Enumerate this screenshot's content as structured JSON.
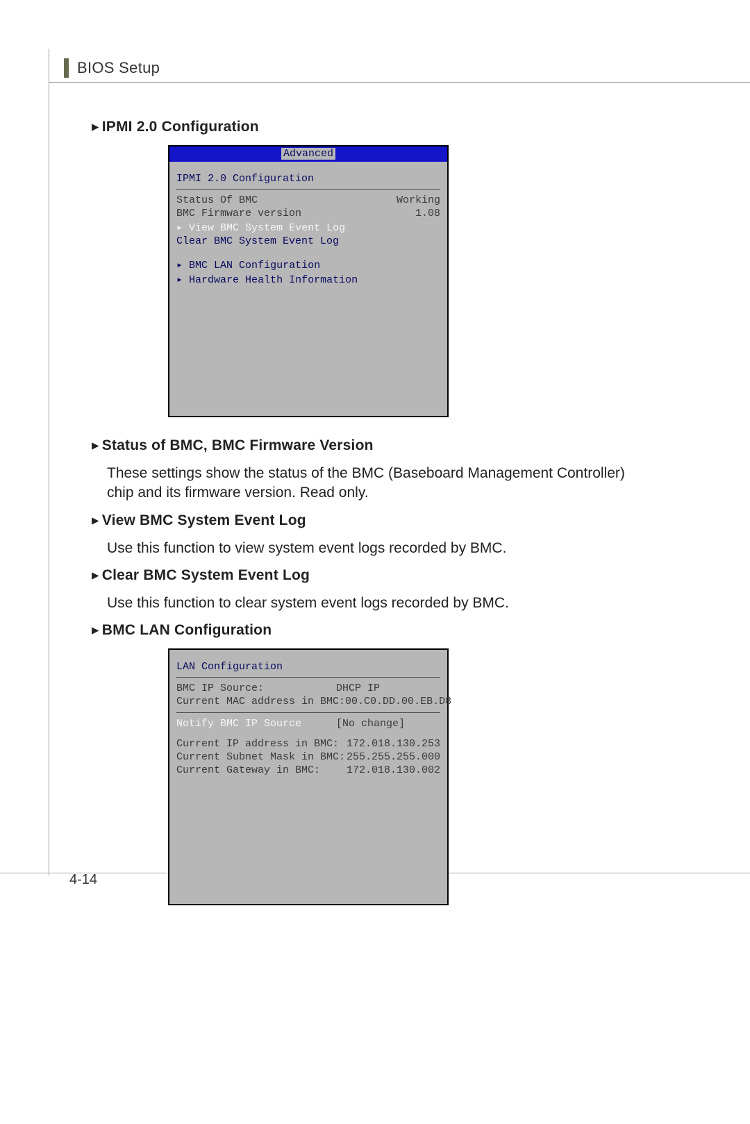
{
  "header": {
    "section": "BIOS Setup"
  },
  "page_number": "4-14",
  "titles": {
    "ipmi": "IPMI 2.0 Configuration",
    "status": "Status of BMC, BMC Firmware Version",
    "view": "View BMC System Event Log",
    "clear": "Clear BMC System Event Log",
    "lan": "BMC LAN Configuration"
  },
  "desc": {
    "status": "These settings show the status of the BMC (Baseboard Management Controller) chip and its firmware version. Read only.",
    "view": "Use this function to view system event logs recorded by BMC.",
    "clear": "Use this function to clear system event logs recorded by BMC."
  },
  "bios1": {
    "tab": "Advanced",
    "title": "IPMI 2.0 Configuration",
    "status_label": "Status Of BMC",
    "status_value": "Working",
    "fw_label": "BMC Firmware version",
    "fw_value": "1.08",
    "menu": {
      "view": "View BMC System Event Log",
      "clear": "Clear BMC System Event Log",
      "lan": "BMC LAN Configuration",
      "hw": "Hardware Health Information"
    }
  },
  "bios2": {
    "title": "LAN Configuration",
    "rows": {
      "src_label": "BMC IP Source:",
      "src_value": "DHCP IP",
      "mac_label": "Current MAC address in BMC:",
      "mac_value": "00.C0.DD.00.EB.D8",
      "notify_label": "Notify BMC IP Source",
      "notify_value": "[No change]",
      "ip_label": "Current IP address in BMC:",
      "ip_value": "172.018.130.253",
      "sn_label": "Current Subnet Mask in BMC:",
      "sn_value": "255.255.255.000",
      "gw_label": "Current Gateway in BMC:",
      "gw_value": "172.018.130.002"
    }
  },
  "glyph": {
    "arrow": "▸",
    "arrow_small": "▸"
  }
}
